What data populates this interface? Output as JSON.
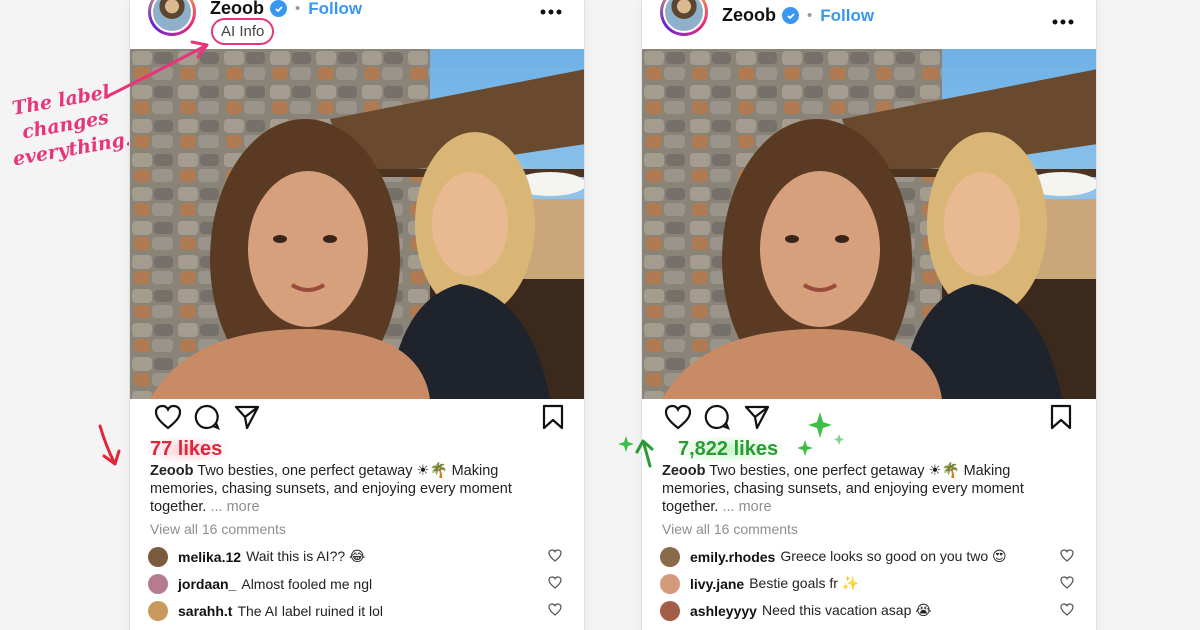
{
  "annotation": {
    "text": "The label changes everything."
  },
  "colors": {
    "accent_pink": "#e8347a",
    "likes_red": "#e0263a",
    "likes_green": "#2a9a34",
    "follow_blue": "#3897f0"
  },
  "posts": [
    {
      "username": "Zeoob",
      "follow_label": "Follow",
      "ai_label": "AI Info",
      "likes": "77 likes",
      "caption": {
        "user": "Zeoob",
        "text": "Two besties, one perfect getaway ☀🌴 Making memories, chasing sunsets, and enjoying every moment together.",
        "more": "... more"
      },
      "view_all": "View all 16 comments",
      "comments": [
        {
          "user": "melika.12",
          "text": "Wait this is AI?? 😂",
          "avatar_color": "#7b5a3e"
        },
        {
          "user": "jordaan_",
          "text": "Almost fooled me ngl",
          "avatar_color": "#b57b8f"
        },
        {
          "user": "sarahh.t",
          "text": "The AI label ruined it lol",
          "avatar_color": "#c89a5e"
        }
      ]
    },
    {
      "username": "Zeoob",
      "follow_label": "Follow",
      "ai_label": "",
      "likes": "7,822 likes",
      "caption": {
        "user": "Zeoob",
        "text": "Two besties, one perfect getaway ☀🌴 Making memories, chasing sunsets, and enjoying every moment together.",
        "more": "... more"
      },
      "view_all": "View all 16 comments",
      "comments": [
        {
          "user": "emily.rhodes",
          "text": "Greece looks so good on you two 😍",
          "avatar_color": "#8a6a4a"
        },
        {
          "user": "livy.jane",
          "text": "Bestie goals fr ✨",
          "avatar_color": "#d49a7c"
        },
        {
          "user": "ashleyyyy",
          "text": "Need this vacation asap 😭",
          "avatar_color": "#a35d48"
        }
      ]
    }
  ],
  "icons": {
    "like": "heart-icon",
    "comment": "comment-bubble-icon",
    "share": "paper-plane-icon",
    "save": "bookmark-icon",
    "more": "more-dots-icon",
    "verified": "verified-badge-icon"
  }
}
